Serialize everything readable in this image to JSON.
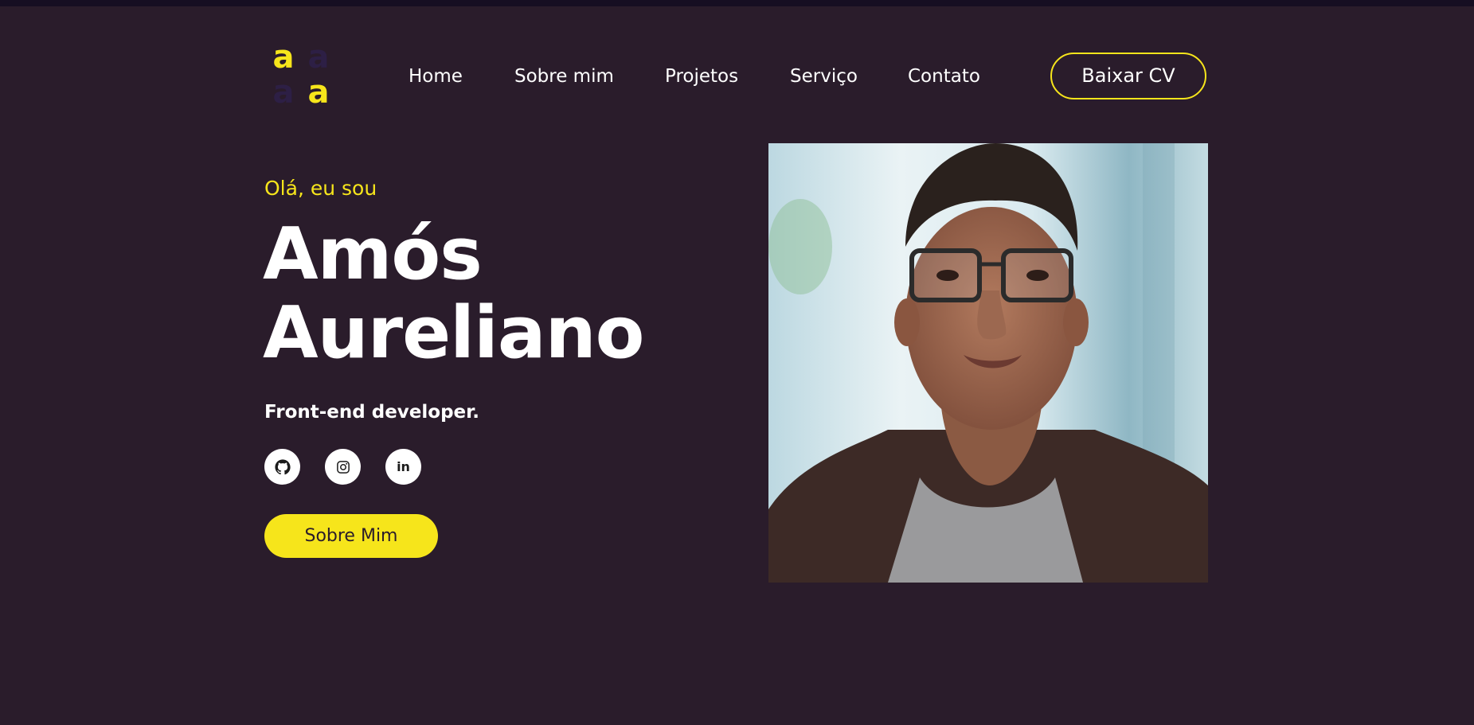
{
  "header": {
    "logo": {
      "icon": "logo-icon",
      "letters": [
        "a",
        "a",
        "a",
        "a"
      ]
    },
    "nav": [
      {
        "label": "Home"
      },
      {
        "label": "Sobre mim"
      },
      {
        "label": "Projetos"
      },
      {
        "label": "Serviço"
      },
      {
        "label": "Contato"
      }
    ],
    "cv_button": "Baixar CV"
  },
  "hero": {
    "greeting": "Olá, eu sou",
    "name_line1": "Amós",
    "name_line2": "Aureliano",
    "role": "Front-end developer.",
    "social": [
      {
        "icon": "github-icon"
      },
      {
        "icon": "instagram-icon"
      },
      {
        "icon": "linkedin-icon",
        "label": "in"
      }
    ],
    "about_button": "Sobre Mim",
    "photo_icon": "profile-photo"
  },
  "colors": {
    "background": "#2a1c2b",
    "accent": "#f6e51b",
    "text": "#ffffff"
  }
}
